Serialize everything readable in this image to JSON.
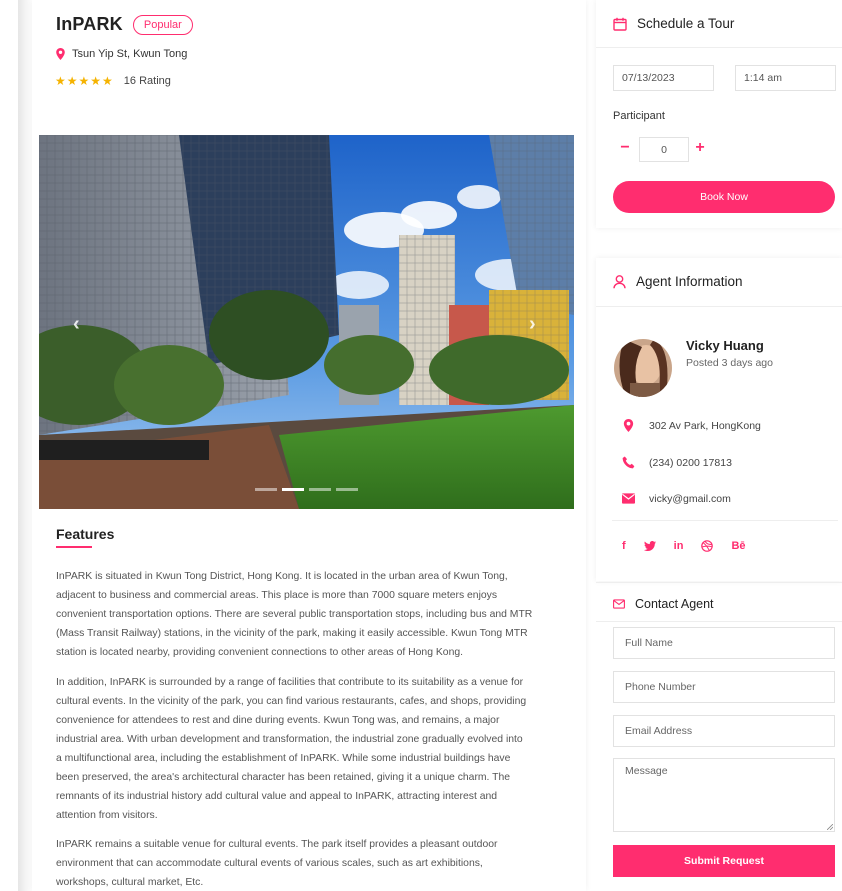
{
  "listing": {
    "title": "InPARK",
    "badge": "Popular",
    "location": "Tsun Yip St, Kwun Tong",
    "stars": "★★★★★",
    "rating_text": "16 Rating",
    "rating_value": 5
  },
  "gallery": {
    "prev_glyph": "‹",
    "next_glyph": "›",
    "slide_count": 4,
    "active_slide": 2
  },
  "features": {
    "title": "Features",
    "paragraphs": [
      [
        "InPARK is situated in Kwun Tong District, Hong Kong. It is located in the urban area of Kwun Tong,",
        "adjacent to business and commercial areas. This place is more than 7000 square meters enjoys",
        "convenient transportation options. There are several public transportation stops, including bus and MTR",
        "(Mass Transit Railway) stations, in the vicinity of the park, making it easily accessible. Kwun Tong MTR",
        "station is located nearby, providing convenient connections to other areas of Hong Kong."
      ],
      [
        "In addition, InPARK is surrounded by a range of facilities that contribute to its suitability as a venue for",
        "cultural events. In the vicinity of the park, you can find various restaurants, cafes, and shops, providing",
        "convenience for attendees to rest and dine during events. Kwun Tong was, and remains, a major",
        "industrial area. With urban development and transformation, the industrial zone gradually evolved into",
        "a multifunctional area, including the establishment of InPARK. While some industrial buildings have",
        "been preserved, the area's architectural character has been retained, giving it a unique charm. The",
        "remnants of its industrial history add cultural value and appeal to InPARK, attracting interest and",
        "attention from visitors."
      ],
      [
        "InPARK remains a suitable venue for cultural events. The park itself provides a pleasant outdoor",
        "environment that can accommodate cultural events of various scales, such as art exhibitions,",
        "workshops, cultural market, Etc."
      ]
    ]
  },
  "schedule": {
    "title": "Schedule a Tour",
    "date": "07/13/2023",
    "time": "1:14 am",
    "participant_label": "Participant",
    "participant_count": "0",
    "minus": "−",
    "plus": "+",
    "book_label": "Book Now"
  },
  "agent": {
    "title": "Agent Information",
    "name": "Vicky Huang",
    "posted": "Posted 3 days ago",
    "address": "302 Av Park, HongKong",
    "phone": "(234) 0200 17813",
    "email": "vicky@gmail.com",
    "socials": [
      "f",
      "in",
      "Bē"
    ]
  },
  "contact": {
    "title": "Contact Agent",
    "full_name_placeholder": "Full Name",
    "phone_placeholder": "Phone Number",
    "email_placeholder": "Email Address",
    "message_placeholder": "Message",
    "submit_label": "Submit Request"
  },
  "colors": {
    "accent": "#ff2d6f",
    "star": "#f5b301"
  }
}
